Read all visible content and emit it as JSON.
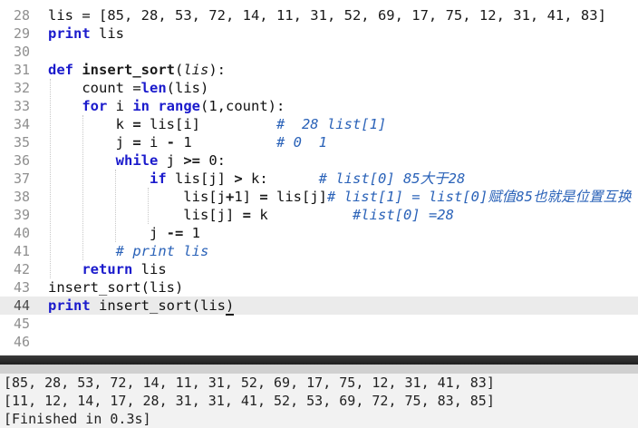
{
  "editor": {
    "lines": [
      {
        "n": "28",
        "tokens": [
          [
            "t",
            "lis = ["
          ],
          [
            "num",
            "85, 28, 53, 72, 14, 11, 31, 52, 69, 17, 75, 12, 31, 41, 83"
          ],
          [
            "t",
            "]"
          ]
        ]
      },
      {
        "n": "29",
        "tokens": [
          [
            "kw",
            "print"
          ],
          [
            "t",
            " lis"
          ]
        ]
      },
      {
        "n": "30",
        "tokens": []
      },
      {
        "n": "31",
        "tokens": [
          [
            "kw",
            "def"
          ],
          [
            "t",
            " "
          ],
          [
            "fn",
            "insert_sort"
          ],
          [
            "t",
            "("
          ],
          [
            "param",
            "lis"
          ],
          [
            "t",
            "):"
          ]
        ]
      },
      {
        "n": "32",
        "tokens": [
          [
            "t",
            "    count ="
          ],
          [
            "bi",
            "len"
          ],
          [
            "t",
            "(lis)"
          ]
        ]
      },
      {
        "n": "33",
        "tokens": [
          [
            "t",
            "    "
          ],
          [
            "kw",
            "for"
          ],
          [
            "t",
            " i "
          ],
          [
            "kw",
            "in"
          ],
          [
            "t",
            " "
          ],
          [
            "bi",
            "range"
          ],
          [
            "t",
            "(1,count):"
          ]
        ]
      },
      {
        "n": "34",
        "tokens": [
          [
            "t",
            "        k "
          ],
          [
            "op",
            "="
          ],
          [
            "t",
            " lis[i]         "
          ],
          [
            "cm",
            "#  28 list[1]"
          ]
        ]
      },
      {
        "n": "35",
        "tokens": [
          [
            "t",
            "        j "
          ],
          [
            "op",
            "="
          ],
          [
            "t",
            " i "
          ],
          [
            "op",
            "-"
          ],
          [
            "t",
            " 1          "
          ],
          [
            "cm",
            "# 0  1"
          ]
        ]
      },
      {
        "n": "36",
        "tokens": [
          [
            "t",
            "        "
          ],
          [
            "kw",
            "while"
          ],
          [
            "t",
            " j "
          ],
          [
            "op",
            ">="
          ],
          [
            "t",
            " 0:"
          ]
        ]
      },
      {
        "n": "37",
        "tokens": [
          [
            "t",
            "            "
          ],
          [
            "kw",
            "if"
          ],
          [
            "t",
            " lis[j] "
          ],
          [
            "op",
            ">"
          ],
          [
            "t",
            " k:      "
          ],
          [
            "cm",
            "# list[0] 85大于28"
          ]
        ]
      },
      {
        "n": "38",
        "tokens": [
          [
            "t",
            "                lis[j"
          ],
          [
            "op",
            "+"
          ],
          [
            "t",
            "1] "
          ],
          [
            "op",
            "="
          ],
          [
            "t",
            " lis[j]"
          ],
          [
            "cm",
            "# list[1] = list[0]赋值85也就是位置互换"
          ]
        ]
      },
      {
        "n": "39",
        "tokens": [
          [
            "t",
            "                lis[j] "
          ],
          [
            "op",
            "="
          ],
          [
            "t",
            " k          "
          ],
          [
            "cm",
            "#list[0] =28"
          ]
        ]
      },
      {
        "n": "40",
        "tokens": [
          [
            "t",
            "            j "
          ],
          [
            "op",
            "-="
          ],
          [
            "t",
            " 1"
          ]
        ]
      },
      {
        "n": "41",
        "tokens": [
          [
            "t",
            "        "
          ],
          [
            "cm",
            "# print lis"
          ]
        ]
      },
      {
        "n": "42",
        "tokens": [
          [
            "t",
            "    "
          ],
          [
            "kw",
            "return"
          ],
          [
            "t",
            " lis"
          ]
        ]
      },
      {
        "n": "43",
        "tokens": [
          [
            "t",
            "insert_sort(lis)"
          ]
        ]
      },
      {
        "n": "44",
        "tokens": [
          [
            "kw",
            "print"
          ],
          [
            "t",
            " insert_sort(lis"
          ],
          [
            "cur",
            ")"
          ]
        ],
        "current": true
      },
      {
        "n": "45",
        "tokens": []
      },
      {
        "n": "46",
        "tokens": []
      }
    ]
  },
  "console": {
    "lines": [
      "[85, 28, 53, 72, 14, 11, 31, 52, 69, 17, 75, 12, 31, 41, 83]",
      "[11, 12, 14, 17, 28, 31, 31, 41, 52, 53, 69, 72, 75, 83, 85]",
      "[Finished in 0.3s]"
    ]
  }
}
